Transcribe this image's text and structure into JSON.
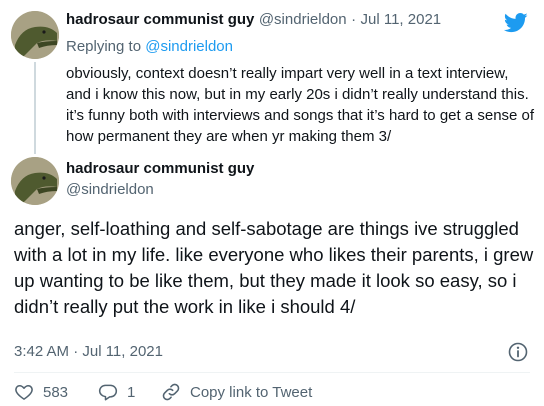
{
  "tweet1": {
    "display_name": "hadrosaur communist guy",
    "handle": "@sindrieldon",
    "separator": "·",
    "date": "Jul 11, 2021",
    "replying_to_prefix": "Replying to",
    "replying_to_handle": "@sindrieldon",
    "text": "obviously, context doesn’t really impart very well in a text interview, and i know this now, but in my early 20s i didn’t really understand this. it’s funny both with interviews and songs that it’s hard to get a sense of how permanent they are when yr making them 3/"
  },
  "tweet2": {
    "display_name": "hadrosaur communist guy",
    "handle": "@sindrieldon",
    "text": "anger, self-loathing and self-sabotage are things ive struggled with a lot in my life. like everyone who likes their parents, i grew up wanting to be like them, but they made it look so easy, so i didn’t really put the work in like i should 4/",
    "timestamp": "3:42 AM · Jul 11, 2021",
    "likes": "583",
    "replies": "1",
    "copy_link_label": "Copy link to Tweet"
  },
  "icons": {
    "brand": "twitter-bird-icon",
    "info": "info-icon",
    "like": "heart-icon",
    "reply": "reply-icon",
    "link": "link-icon"
  },
  "colors": {
    "accent": "#1d9bf0",
    "text": "#0f1419",
    "muted": "#536471"
  }
}
